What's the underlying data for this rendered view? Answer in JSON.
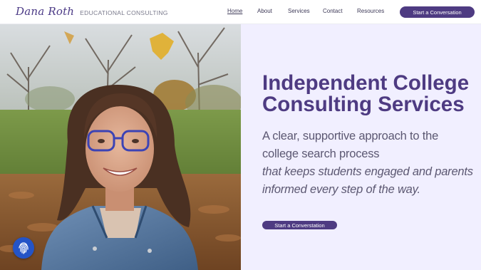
{
  "brand": {
    "name": "Dana Roth",
    "tagline": "EDUCATIONAL CONSULTING"
  },
  "nav": {
    "items": [
      "Home",
      "About",
      "Services",
      "Contact",
      "Resources"
    ],
    "active": "Home"
  },
  "header_cta": "Start a Conversation",
  "hero": {
    "title": "Independent College Consulting Services",
    "subtitle_lines": [
      "A clear, supportive approach to the",
      "college search process",
      "that keeps students engaged and parents",
      "informed every step of the way."
    ],
    "cta": "Start a Converstation"
  },
  "colors": {
    "brand_purple": "#4e3b82",
    "hero_background": "#f1efff",
    "chat_badge": "#2454c7"
  },
  "icons": {
    "chat_badge": "fingerprint-icon"
  }
}
